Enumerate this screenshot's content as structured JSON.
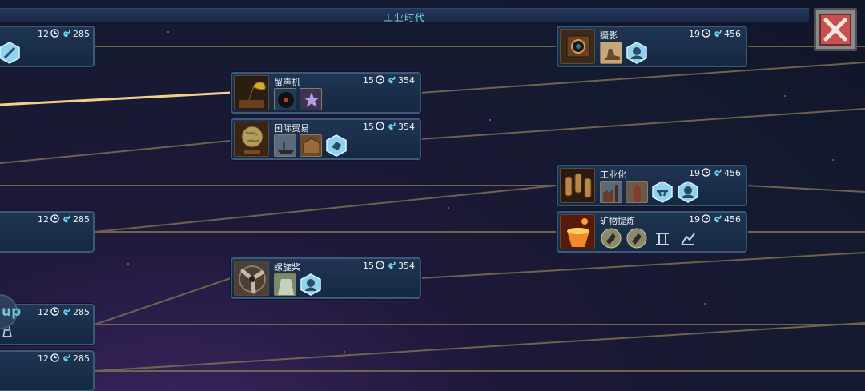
{
  "era_title": "工业时代",
  "colors": {
    "link": "#8a7a5a",
    "active_link": "#f2d08a",
    "card_bg": "#1b3049",
    "accent_cyan": "#6fd7e8",
    "hex_badge": "#8ed3f0",
    "close_red": "#c8504e"
  },
  "cards": {
    "photography": {
      "name": "摄影",
      "turns": "19",
      "science": "456",
      "thumb_icon": "camera-icon"
    },
    "gramophone": {
      "name": "留声机",
      "turns": "15",
      "science": "354",
      "thumb_icon": "gramophone-icon"
    },
    "trade": {
      "name": "国际贸易",
      "turns": "15",
      "science": "354",
      "thumb_icon": "globe-icon"
    },
    "industrialization": {
      "name": "工业化",
      "turns": "19",
      "science": "456",
      "thumb_icon": "shells-icon"
    },
    "mining": {
      "name": "矿物提炼",
      "turns": "19",
      "science": "456",
      "thumb_icon": "smelting-icon"
    },
    "propeller": {
      "name": "螺旋桨",
      "turns": "15",
      "science": "354",
      "thumb_icon": "propeller-icon"
    }
  },
  "left_cards": [
    {
      "turns": "12",
      "science": "285"
    },
    {
      "turns": "12",
      "science": "285"
    },
    {
      "turns": "12",
      "science": "285"
    },
    {
      "turns": "12",
      "science": "285"
    }
  ],
  "mp_label": "up"
}
